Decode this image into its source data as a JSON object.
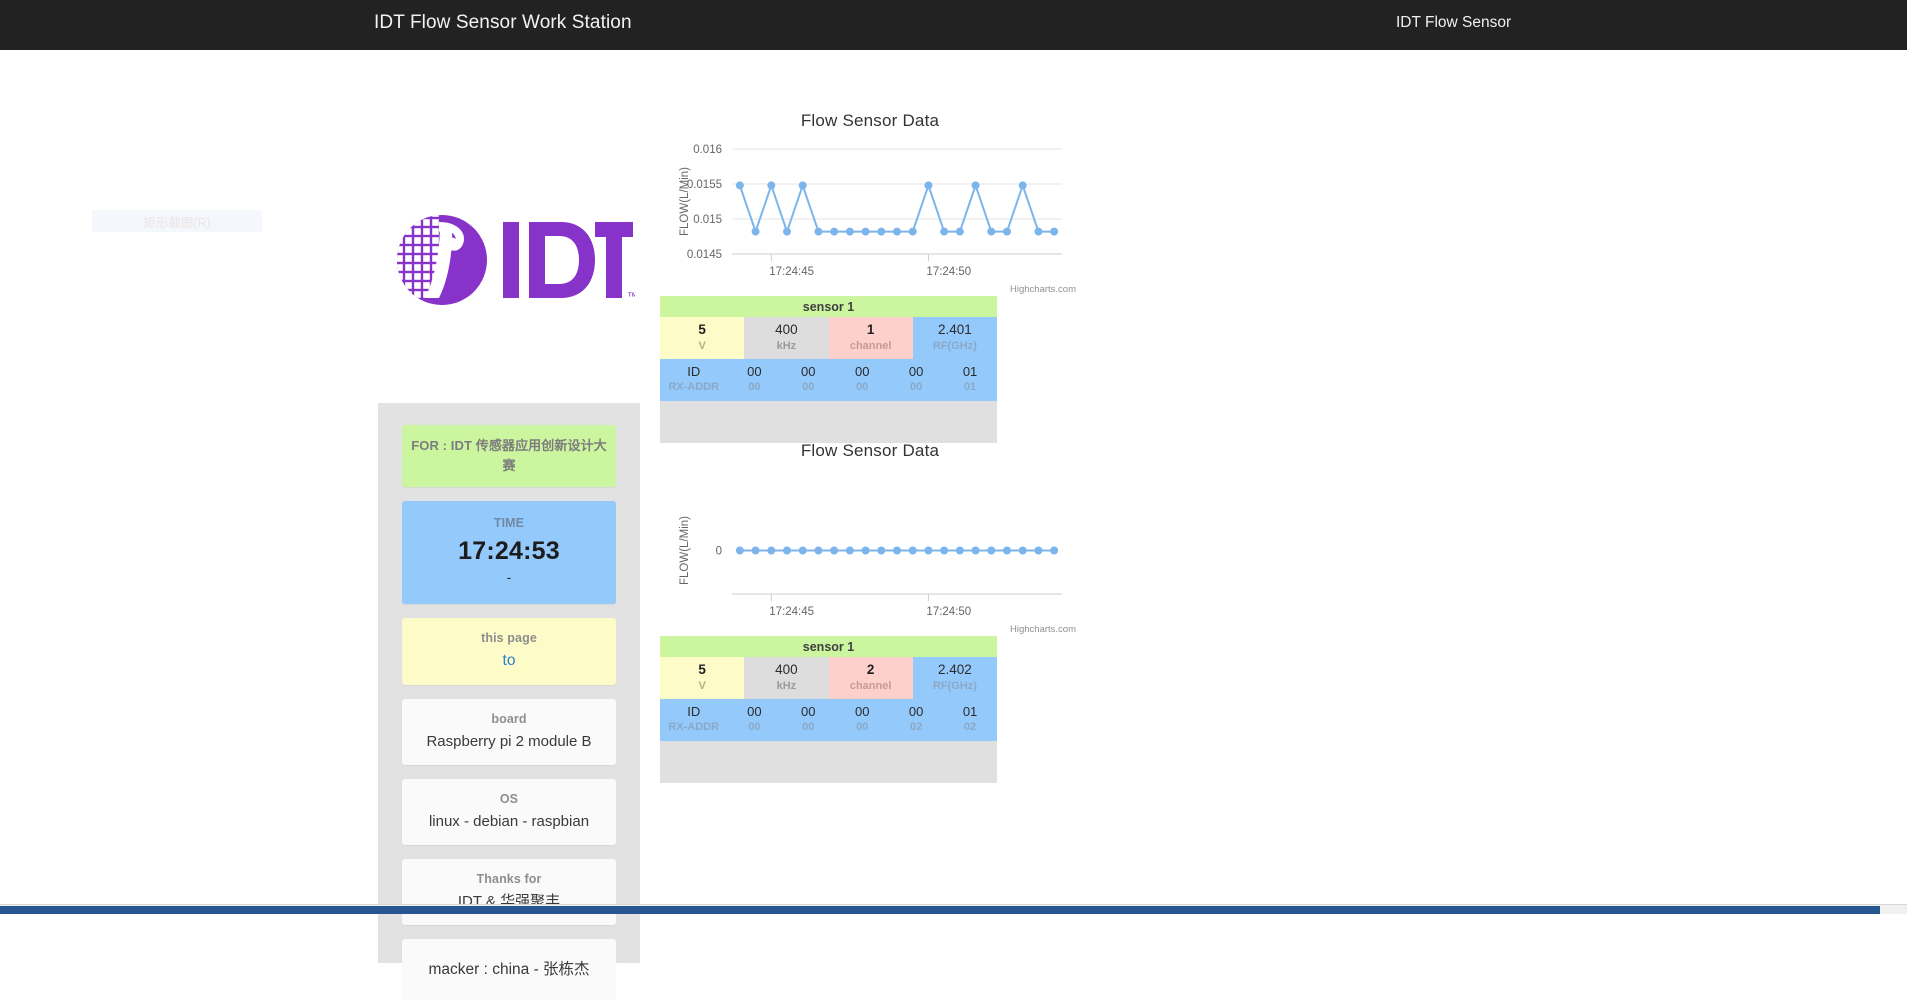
{
  "topbar": {
    "title": "IDT Flow Sensor Work Station",
    "brand": "IDT Flow Sensor"
  },
  "overlay": {
    "ghost_chip_label": "矩形截图(R)"
  },
  "logo": {
    "name": "IDT",
    "trademark": "™",
    "color": "#8733c9"
  },
  "info_panel": {
    "cards": [
      {
        "label": "FOR : IDT 传感器应用创新设计大赛",
        "value": "",
        "style": "green"
      },
      {
        "label": "TIME",
        "value": "17:24:53",
        "sub": "-",
        "style": "blue"
      },
      {
        "label": "this page",
        "value": "to",
        "style": "yellow"
      },
      {
        "label": "board",
        "value": "Raspberry pi 2 module B",
        "style": "plain"
      },
      {
        "label": "OS",
        "value": "linux - debian - raspbian",
        "style": "plain"
      },
      {
        "label": "Thanks for",
        "value": "IDT & 华强聚丰",
        "style": "plain"
      },
      {
        "label": "",
        "value": "macker : china - 张栋杰",
        "style": "plain-only"
      }
    ]
  },
  "panels": [
    {
      "chart_index": 0,
      "sensor": {
        "header": "sensor 1",
        "metrics": [
          {
            "value": "5",
            "unit": "V",
            "color": "#fdfbc8",
            "bold": true
          },
          {
            "value": "400",
            "unit": "kHz",
            "color": "#dddddd",
            "bold": false
          },
          {
            "value": "1",
            "unit": "channel",
            "color": "#fdd0cc",
            "bold": true
          },
          {
            "value": "2.401",
            "unit": "RF(GHz)",
            "color": "#94c9fb",
            "bold": false
          }
        ],
        "id_label": "ID",
        "addr_label": "RX-ADDR",
        "id_bytes": [
          "00",
          "00",
          "00",
          "00",
          "01"
        ],
        "addr_bytes": [
          "00",
          "00",
          "00",
          "00",
          "01"
        ]
      }
    },
    {
      "chart_index": 1,
      "sensor": {
        "header": "sensor 1",
        "metrics": [
          {
            "value": "5",
            "unit": "V",
            "color": "#fdfbc8",
            "bold": true
          },
          {
            "value": "400",
            "unit": "kHz",
            "color": "#dddddd",
            "bold": false
          },
          {
            "value": "2",
            "unit": "channel",
            "color": "#fdd0cc",
            "bold": true
          },
          {
            "value": "2.402",
            "unit": "RF(GHz)",
            "color": "#94c9fb",
            "bold": false
          }
        ],
        "id_label": "ID",
        "addr_label": "RX-ADDR",
        "id_bytes": [
          "00",
          "00",
          "00",
          "00",
          "01"
        ],
        "addr_bytes": [
          "00",
          "00",
          "00",
          "02",
          "02"
        ]
      }
    }
  ],
  "chart_data": [
    {
      "type": "line",
      "title": "Flow Sensor Data",
      "xlabel": "",
      "ylabel": "FLOW(L/Min)",
      "credits": "Highcharts.com",
      "series_color": "#7cb5ec",
      "grid": true,
      "legend": "none",
      "ylim": [
        0.0145,
        0.016
      ],
      "yticks": [
        0.0145,
        0.015,
        0.0155,
        0.016
      ],
      "ytick_labels": [
        "0.0145",
        "0.015",
        "0.0155",
        "0.016"
      ],
      "xtick_labels": [
        "17:24:45",
        "17:24:50"
      ],
      "xtick_positions": [
        2,
        12
      ],
      "x": [
        0,
        1,
        2,
        3,
        4,
        5,
        6,
        7,
        8,
        9,
        10,
        11,
        12,
        13,
        14,
        15,
        16,
        17,
        18,
        19,
        20
      ],
      "values": [
        0.01548,
        0.01482,
        0.01548,
        0.01482,
        0.01548,
        0.01482,
        0.01482,
        0.01482,
        0.01482,
        0.01482,
        0.01482,
        0.01482,
        0.01548,
        0.01482,
        0.01482,
        0.01548,
        0.01482,
        0.01482,
        0.01548,
        0.01482,
        0.01482
      ]
    },
    {
      "type": "line",
      "title": "Flow Sensor Data",
      "xlabel": "",
      "ylabel": "FLOW(L/Min)",
      "credits": "Highcharts.com",
      "series_color": "#7cb5ec",
      "grid": false,
      "legend": "none",
      "ylim": [
        -1,
        1
      ],
      "yticks": [
        0
      ],
      "ytick_labels": [
        "0"
      ],
      "xtick_labels": [
        "17:24:45",
        "17:24:50"
      ],
      "xtick_positions": [
        2,
        12
      ],
      "x": [
        0,
        1,
        2,
        3,
        4,
        5,
        6,
        7,
        8,
        9,
        10,
        11,
        12,
        13,
        14,
        15,
        16,
        17,
        18,
        19,
        20
      ],
      "values": [
        0,
        0,
        0,
        0,
        0,
        0,
        0,
        0,
        0,
        0,
        0,
        0,
        0,
        0,
        0,
        0,
        0,
        0,
        0,
        0,
        0
      ]
    }
  ]
}
